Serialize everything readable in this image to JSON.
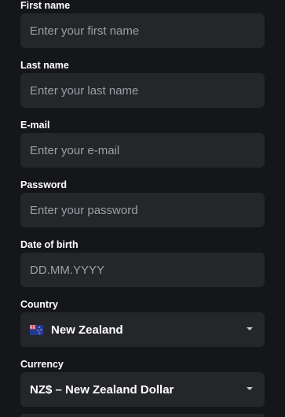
{
  "form": {
    "first_name": {
      "label": "First name",
      "placeholder": "Enter your first name",
      "value": ""
    },
    "last_name": {
      "label": "Last name",
      "placeholder": "Enter your last name",
      "value": ""
    },
    "email": {
      "label": "E-mail",
      "placeholder": "Enter your e-mail",
      "value": ""
    },
    "password": {
      "label": "Password",
      "placeholder": "Enter your password",
      "value": ""
    },
    "date_of_birth": {
      "label": "Date of birth",
      "placeholder": "DD.MM.YYYY",
      "value": ""
    },
    "country": {
      "label": "Country",
      "selected": "New Zealand",
      "flag_icon": "new-zealand-flag-icon"
    },
    "currency": {
      "label": "Currency",
      "selected": "NZ$ – New Zealand Dollar"
    }
  },
  "colors": {
    "background": "#151619",
    "field_background": "#242629",
    "placeholder": "#9aa0a6",
    "text": "#ffffff"
  }
}
